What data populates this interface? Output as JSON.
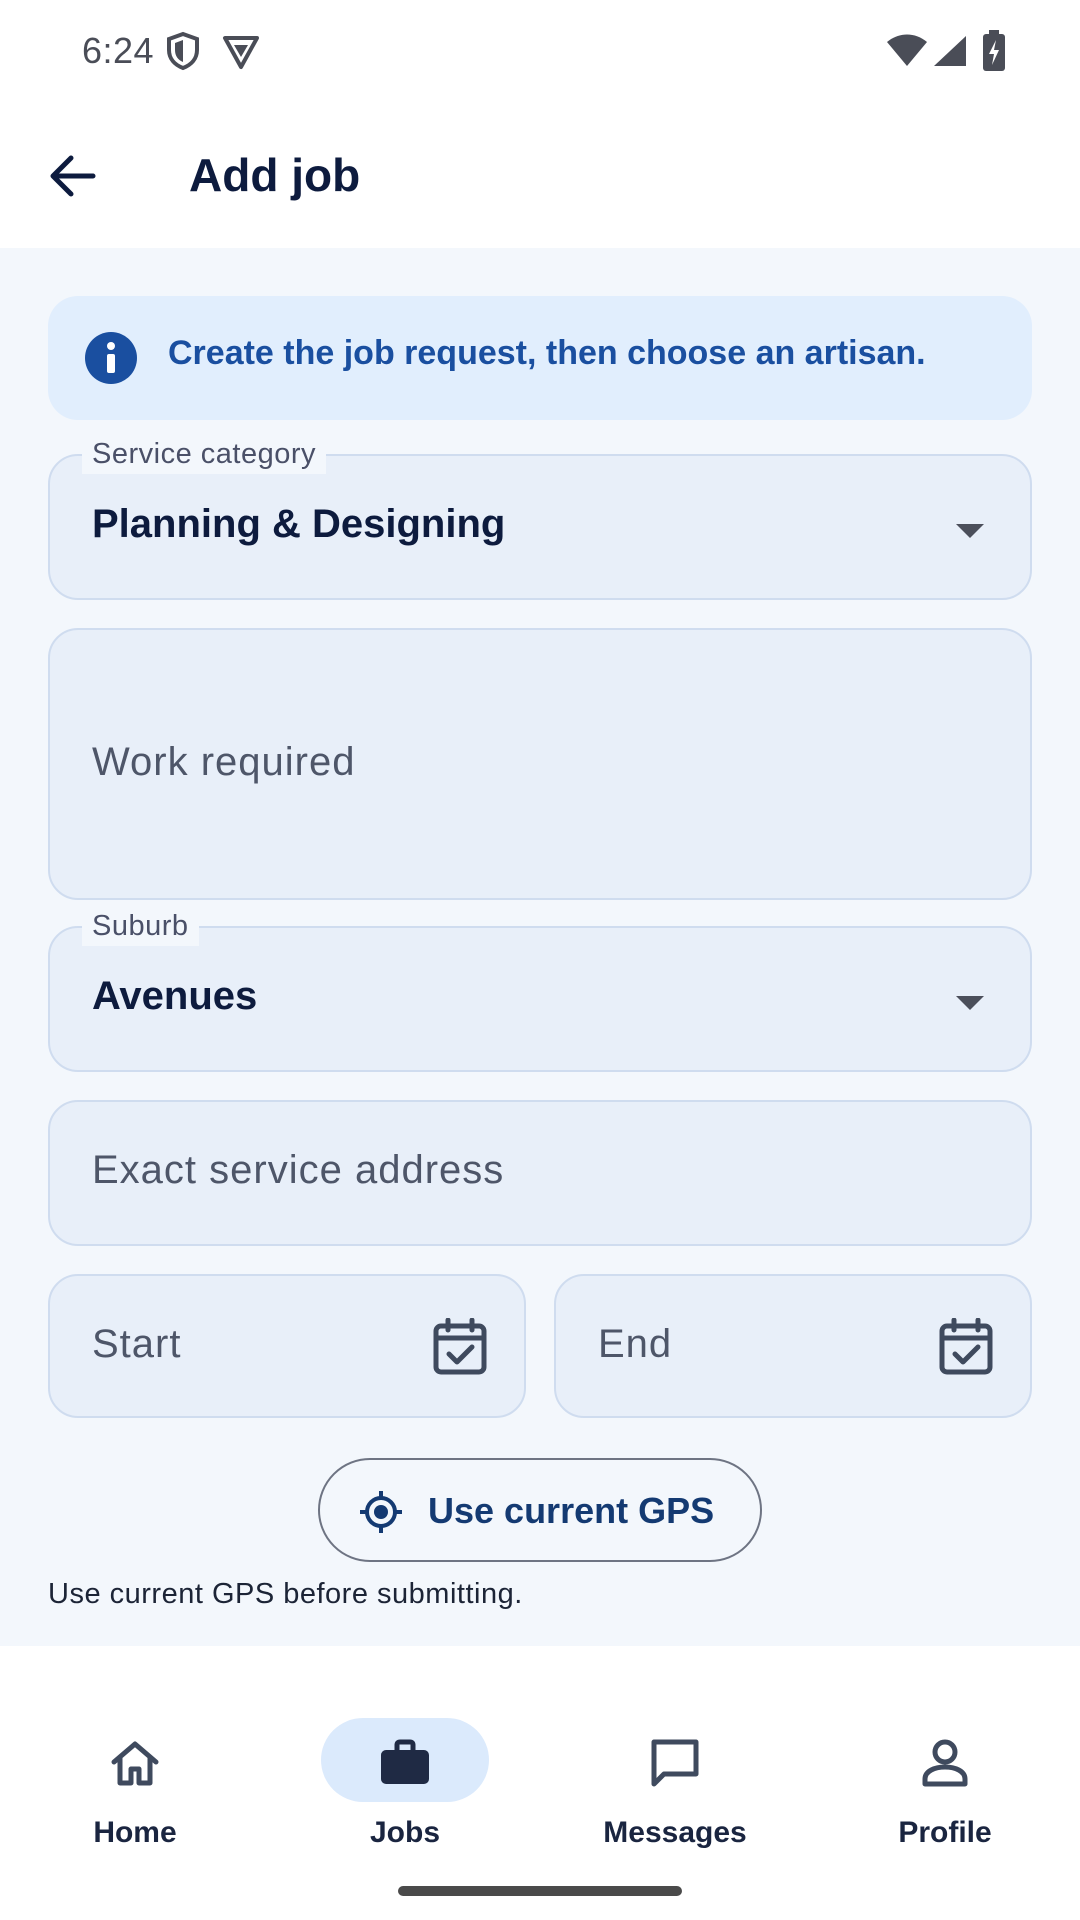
{
  "status_bar": {
    "time": "6:24"
  },
  "app_bar": {
    "title": "Add job"
  },
  "info_banner": {
    "text": "Create the job request, then choose an artisan."
  },
  "form": {
    "service_category": {
      "label": "Service category",
      "value": "Planning & Designing"
    },
    "work_required": {
      "placeholder": "Work required"
    },
    "suburb": {
      "label": "Suburb",
      "value": "Avenues"
    },
    "address": {
      "placeholder": "Exact service address"
    },
    "start": {
      "placeholder": "Start"
    },
    "end": {
      "placeholder": "End"
    },
    "gps_button": {
      "label": "Use current GPS"
    },
    "hint": "Use current GPS before submitting."
  },
  "bottom_nav": {
    "items": [
      {
        "label": "Home",
        "icon": "home-icon",
        "active": false
      },
      {
        "label": "Jobs",
        "icon": "briefcase-icon",
        "active": true
      },
      {
        "label": "Messages",
        "icon": "chat-icon",
        "active": false
      },
      {
        "label": "Profile",
        "icon": "person-icon",
        "active": false
      }
    ]
  },
  "colors": {
    "accent": "#1a4fa0",
    "content_bg": "#f3f7fc",
    "field_bg": "#e8eff9",
    "banner_bg": "#e1eefd",
    "nav_active_pill": "#dbeafc",
    "text_primary": "#0d1b3e"
  }
}
